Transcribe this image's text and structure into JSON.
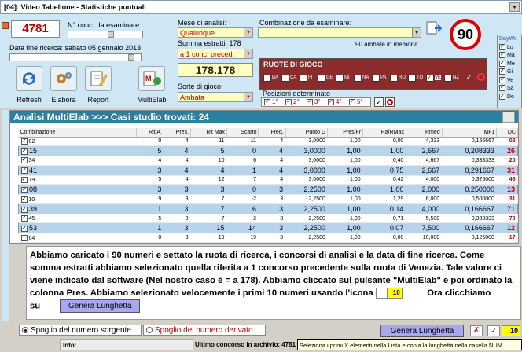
{
  "window": {
    "title": "[04]: Video Tabellone - Statistiche puntuali"
  },
  "controls": {
    "conc_value": "4781",
    "conc_label": "N° conc. da esaminare",
    "data_fine_label": "Data fine ricerca: sabato 05 gennaio 2013",
    "mese_label": "Mese di analisi:",
    "mese_value": "Qualunque",
    "somma_label": "Somma estratti: 178",
    "somma_value": "a 1 conc. preced.",
    "somma_result": "178.178",
    "sorte_label": "Sorte di gioco:",
    "sorte_value": "Ambata",
    "combinazione_label": "Combinazione da esaminare:",
    "ambate_text": "90 ambate in memoria",
    "ruote_title": "RUOTE DI GIOCO",
    "ruote": [
      "BA",
      "CA",
      "FI",
      "GE",
      "MI",
      "NA",
      "PA",
      "RO",
      "TO",
      "VE",
      "NZ"
    ],
    "posizioni_label": "Posizioni determinate",
    "posizioni": [
      "1°",
      "2°",
      "3°",
      "4°",
      "5°"
    ],
    "big_number": "90",
    "days_title": "DayWe",
    "days": [
      "Lu",
      "Ma",
      "Me",
      "Gi",
      "Ve",
      "Sa",
      "Do"
    ]
  },
  "buttons": {
    "refresh": "Refresh",
    "elabora": "Elabora",
    "report": "Report",
    "multielab": "MultiElab"
  },
  "grid": {
    "header": "Analisi MultiElab >>> Casi studio trovati: 24",
    "columns": [
      "Combinazione",
      "Rit A.",
      "Pres.",
      "Rit Max",
      "Scarto",
      "Freq.",
      "Punto G",
      "Pres/Fr",
      "Ra/RMax",
      "Rmed",
      "MF1",
      "DC"
    ],
    "rows": [
      {
        "comb": "02",
        "rit": "0",
        "pres": "4",
        "ritmax": "11",
        "scarto": "11",
        "freq": "4",
        "puntog": "3,0000",
        "presfr": "1,00",
        "rarmax": "0,00",
        "rmed": "4,333",
        "mf1": "0,166667",
        "dc": "02",
        "checked": true
      },
      {
        "comb": "15",
        "rit": "5",
        "pres": "4",
        "ritmax": "5",
        "scarto": "0",
        "freq": "4",
        "puntog": "3,0000",
        "presfr": "1,00",
        "rarmax": "1,00",
        "rmed": "2,667",
        "mf1": "0,208333",
        "dc": "26",
        "checked": true
      },
      {
        "comb": "34",
        "rit": "4",
        "pres": "4",
        "ritmax": "10",
        "scarto": "6",
        "freq": "4",
        "puntog": "3,0000",
        "presfr": "1,00",
        "rarmax": "0,40",
        "rmed": "4,667",
        "mf1": "0,333333",
        "dc": "20",
        "checked": true
      },
      {
        "comb": "41",
        "rit": "3",
        "pres": "4",
        "ritmax": "4",
        "scarto": "1",
        "freq": "4",
        "puntog": "3,0000",
        "presfr": "1,00",
        "rarmax": "0,75",
        "rmed": "2,667",
        "mf1": "0,291667",
        "dc": "31",
        "checked": true
      },
      {
        "comb": "79",
        "rit": "5",
        "pres": "4",
        "ritmax": "12",
        "scarto": "7",
        "freq": "4",
        "puntog": "3,0000",
        "presfr": "1,00",
        "rarmax": "0,42",
        "rmed": "4,000",
        "mf1": "0,375000",
        "dc": "46",
        "checked": true
      },
      {
        "comb": "08",
        "rit": "3",
        "pres": "3",
        "ritmax": "3",
        "scarto": "0",
        "freq": "3",
        "puntog": "2,2500",
        "presfr": "1,00",
        "rarmax": "1,00",
        "rmed": "2,000",
        "mf1": "0,250000",
        "dc": "13",
        "checked": true
      },
      {
        "comb": "10",
        "rit": "9",
        "pres": "3",
        "ritmax": "7",
        "scarto": "-2",
        "freq": "3",
        "puntog": "2,2500",
        "presfr": "1,00",
        "rarmax": "1,29",
        "rmed": "6,000",
        "mf1": "0,500000",
        "dc": "31",
        "checked": true
      },
      {
        "comb": "39",
        "rit": "1",
        "pres": "3",
        "ritmax": "7",
        "scarto": "6",
        "freq": "3",
        "puntog": "2,2500",
        "presfr": "1,00",
        "rarmax": "0,14",
        "rmed": "4,000",
        "mf1": "0,166667",
        "dc": "71",
        "checked": true
      },
      {
        "comb": "45",
        "rit": "5",
        "pres": "3",
        "ritmax": "7",
        "scarto": "2",
        "freq": "3",
        "puntog": "2,2500",
        "presfr": "1,00",
        "rarmax": "0,71",
        "rmed": "5,500",
        "mf1": "0,333333",
        "dc": "70",
        "checked": true
      },
      {
        "comb": "53",
        "rit": "1",
        "pres": "3",
        "ritmax": "15",
        "scarto": "14",
        "freq": "3",
        "puntog": "2,2500",
        "presfr": "1,00",
        "rarmax": "0,07",
        "rmed": "7,500",
        "mf1": "0,166667",
        "dc": "12",
        "checked": true
      },
      {
        "comb": "64",
        "rit": "0",
        "pres": "3",
        "ritmax": "19",
        "scarto": "19",
        "freq": "3",
        "puntog": "2,2500",
        "presfr": "1,00",
        "rarmax": "0,00",
        "rmed": "10,000",
        "mf1": "0,125000",
        "dc": "17",
        "checked": false
      }
    ]
  },
  "note": {
    "text": "Abbiamo caricato i 90 numeri e settato la ruota di ricerca, i concorsi di analisi e la data di fine ricerca. Come somma estratti abbiamo selezionato quella riferita a 1 concorso precedente sulla ruota di Venezia. Tale valore ci viene indicato dal software (Nel nostro caso è = a 178). Abbiamo cliccato sul pulsante \"MultiElab\" e poi ordinato la colonna Pres. Abbiamo selezionato velocemente i primi 10 numeri usando l'icona",
    "icon_value": "10",
    "after_icon": "Ora clicchiamo su",
    "button_label": "Genera Lunghetta"
  },
  "bottom": {
    "spoglio_sorgente": "Spoglio del numero sorgente",
    "spoglio_derivato": "Spoglio del numero derivato",
    "genera_label": "Genera Lunghetta",
    "count_value": "10",
    "info_label": "Info:",
    "ultimo_concorso": "Ultimo concorso in archivio: 4781 e",
    "tooltip": "Seleziona i primi X elementi nella Lista e copia la lunghetta nella casella NUM"
  },
  "colors": {
    "accent": "#2d7fa0",
    "selected_row": "#b8d4ec",
    "dc_red": "#c00000",
    "ruote_bg": "#8c2b2b"
  }
}
